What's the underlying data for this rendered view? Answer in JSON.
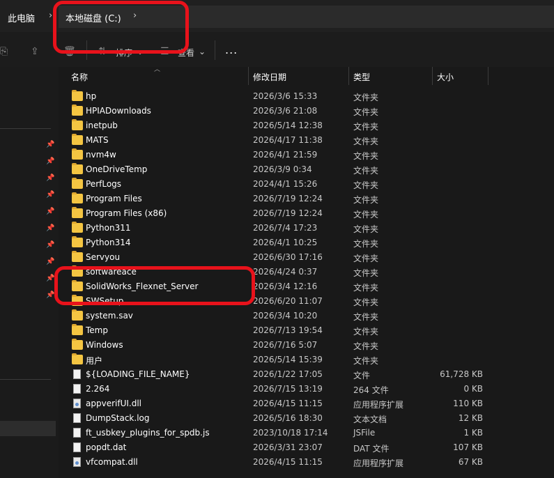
{
  "breadcrumb": {
    "items": [
      "此电脑",
      "本地磁盘 (C:)"
    ],
    "separator": "›"
  },
  "toolbar": {
    "sort_label": "排序",
    "view_label": "查看",
    "more_label": "..."
  },
  "columns": {
    "name": "名称",
    "date": "修改日期",
    "type": "类型",
    "size": "大小"
  },
  "files": [
    {
      "name": "hp",
      "date": "2026/3/6 15:33",
      "type": "文件夹",
      "size": "",
      "icon": "folder"
    },
    {
      "name": "HPIADownloads",
      "date": "2026/3/6 21:08",
      "type": "文件夹",
      "size": "",
      "icon": "folder"
    },
    {
      "name": "inetpub",
      "date": "2026/5/14 12:38",
      "type": "文件夹",
      "size": "",
      "icon": "folder"
    },
    {
      "name": "MATS",
      "date": "2026/4/17 11:38",
      "type": "文件夹",
      "size": "",
      "icon": "folder"
    },
    {
      "name": "nvm4w",
      "date": "2026/4/1 21:59",
      "type": "文件夹",
      "size": "",
      "icon": "folder"
    },
    {
      "name": "OneDriveTemp",
      "date": "2026/3/9 0:34",
      "type": "文件夹",
      "size": "",
      "icon": "folder"
    },
    {
      "name": "PerfLogs",
      "date": "2024/4/1 15:26",
      "type": "文件夹",
      "size": "",
      "icon": "folder"
    },
    {
      "name": "Program Files",
      "date": "2026/7/19 12:24",
      "type": "文件夹",
      "size": "",
      "icon": "folder"
    },
    {
      "name": "Program Files (x86)",
      "date": "2026/7/19 12:24",
      "type": "文件夹",
      "size": "",
      "icon": "folder"
    },
    {
      "name": "Python311",
      "date": "2026/7/4 17:23",
      "type": "文件夹",
      "size": "",
      "icon": "folder"
    },
    {
      "name": "Python314",
      "date": "2026/4/1 10:25",
      "type": "文件夹",
      "size": "",
      "icon": "folder"
    },
    {
      "name": "Servyou",
      "date": "2026/6/30 17:16",
      "type": "文件夹",
      "size": "",
      "icon": "folder"
    },
    {
      "name": "softwareace",
      "date": "2026/4/24 0:37",
      "type": "文件夹",
      "size": "",
      "icon": "folder"
    },
    {
      "name": "SolidWorks_Flexnet_Server",
      "date": "2026/3/4 12:16",
      "type": "文件夹",
      "size": "",
      "icon": "folder"
    },
    {
      "name": "SWSetup",
      "date": "2026/6/20 11:07",
      "type": "文件夹",
      "size": "",
      "icon": "folder"
    },
    {
      "name": "system.sav",
      "date": "2026/3/4 10:20",
      "type": "文件夹",
      "size": "",
      "icon": "folder"
    },
    {
      "name": "Temp",
      "date": "2026/7/13 19:54",
      "type": "文件夹",
      "size": "",
      "icon": "folder"
    },
    {
      "name": "Windows",
      "date": "2026/7/16 5:07",
      "type": "文件夹",
      "size": "",
      "icon": "folder"
    },
    {
      "name": "用户",
      "date": "2026/5/14 15:39",
      "type": "文件夹",
      "size": "",
      "icon": "folder"
    },
    {
      "name": "${LOADING_FILE_NAME}",
      "date": "2026/1/22 17:05",
      "type": "文件",
      "size": "61,728 KB",
      "icon": "file"
    },
    {
      "name": "2.264",
      "date": "2026/7/15 13:19",
      "type": "264 文件",
      "size": "0 KB",
      "icon": "file"
    },
    {
      "name": "appverifUI.dll",
      "date": "2026/4/15 11:15",
      "type": "应用程序扩展",
      "size": "110 KB",
      "icon": "dll"
    },
    {
      "name": "DumpStack.log",
      "date": "2026/5/16 18:30",
      "type": "文本文档",
      "size": "12 KB",
      "icon": "file"
    },
    {
      "name": "ft_usbkey_plugins_for_spdb.js",
      "date": "2023/10/18 17:14",
      "type": "JSFile",
      "size": "1 KB",
      "icon": "file"
    },
    {
      "name": "popdt.dat",
      "date": "2026/3/31 23:07",
      "type": "DAT 文件",
      "size": "107 KB",
      "icon": "file"
    },
    {
      "name": "vfcompat.dll",
      "date": "2026/4/15 11:15",
      "type": "应用程序扩展",
      "size": "67 KB",
      "icon": "dll"
    }
  ],
  "colors": {
    "background": "#191919",
    "highlight": "#e8121b",
    "folder": "#f4c542"
  }
}
